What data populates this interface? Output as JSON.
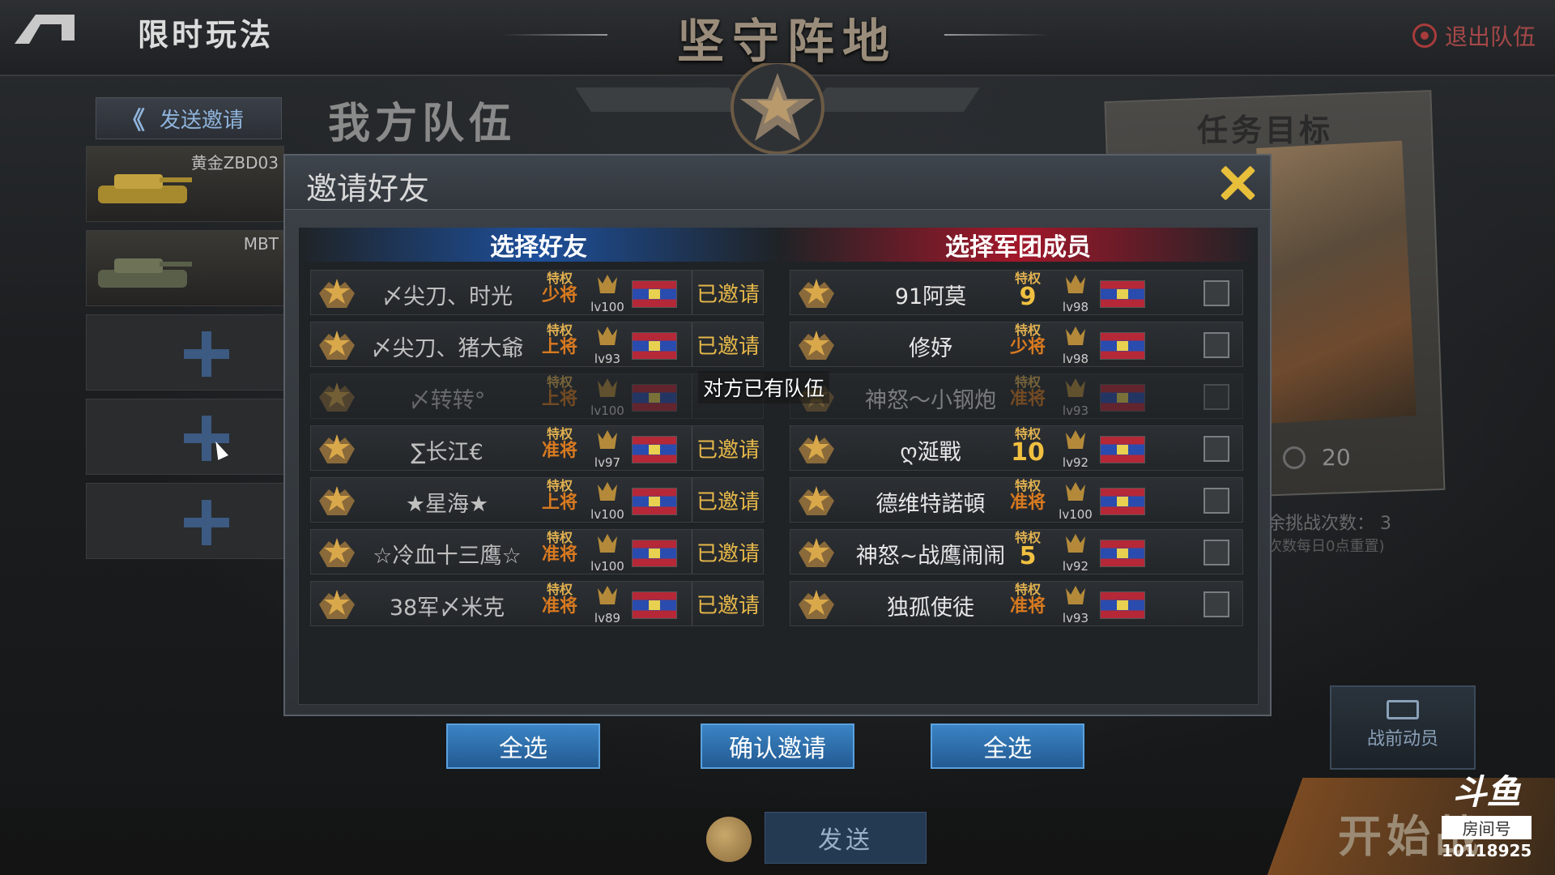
{
  "header": {
    "mode_title": "限时玩法",
    "main_title": "坚守阵地",
    "leave_team_label": "退出队伍"
  },
  "left_panel": {
    "send_invite_label": "发送邀请",
    "our_team_title": "我方队伍",
    "slots": [
      {
        "name": "黄金ZBD03"
      },
      {
        "name": "MBT"
      }
    ]
  },
  "mission": {
    "title": "任务目标",
    "reward_value": "20",
    "remaining_label": "余挑战次数：",
    "remaining_value": "3",
    "reset_note": "次数每日0点重置)"
  },
  "mobilize_label": "战前动员",
  "start_label": "开始战",
  "chat": {
    "send_label": "发送"
  },
  "watermark": {
    "logo": "斗鱼",
    "room_label": "房间号",
    "room_number": "10118925"
  },
  "dialog": {
    "title": "邀请好友",
    "friends_header": "选择好友",
    "legion_header": "选择军团成员",
    "toast": "对方已有队伍",
    "select_all_left": "全选",
    "confirm_invite": "确认邀请",
    "select_all_right": "全选",
    "friends": [
      {
        "name": "〆尖刀、时光",
        "badge_top": "特权",
        "badge_rank": "少将",
        "level": "lv100",
        "status": "已邀请"
      },
      {
        "name": "〆尖刀、猪大爺",
        "badge_top": "特权",
        "badge_rank": "上将",
        "level": "lv93",
        "status": "已邀请"
      },
      {
        "name": "〆转转°",
        "badge_top": "特权",
        "badge_rank": "上将",
        "level": "lv100",
        "status": ""
      },
      {
        "name": "∑长江€",
        "badge_top": "特权",
        "badge_rank": "准将",
        "level": "lv97",
        "status": "已邀请"
      },
      {
        "name": "★星海★",
        "badge_top": "特权",
        "badge_rank": "上将",
        "level": "lv100",
        "status": "已邀请"
      },
      {
        "name": "☆冷血十三鹰☆",
        "badge_top": "特权",
        "badge_rank": "准将",
        "level": "lv100",
        "status": "已邀请"
      },
      {
        "name": "38军〆米克",
        "badge_top": "特权",
        "badge_rank": "准将",
        "level": "lv89",
        "status": "已邀请"
      }
    ],
    "legion": [
      {
        "name": "91阿莫",
        "badge_top": "特权",
        "badge_rank": "9",
        "level": "lv98"
      },
      {
        "name": "修妤",
        "badge_top": "特权",
        "badge_rank": "少将",
        "level": "lv98"
      },
      {
        "name": "神怒～小钢炮",
        "badge_top": "特权",
        "badge_rank": "准将",
        "level": "lv93"
      },
      {
        "name": "ღ涎戰",
        "badge_top": "特权",
        "badge_rank": "10",
        "level": "lv92"
      },
      {
        "name": "德维特諾頓",
        "badge_top": "特权",
        "badge_rank": "准将",
        "level": "lv100"
      },
      {
        "name": "神怒~战鹰闹闹",
        "badge_top": "特权",
        "badge_rank": "5",
        "level": "lv92"
      },
      {
        "name": "独孤使徒",
        "badge_top": "特权",
        "badge_rank": "准将",
        "level": "lv93"
      }
    ]
  },
  "colors": {
    "accent_gold": "#e6b84a",
    "friends_header": "#1e4f9a",
    "legion_header": "#a2172a",
    "button_blue": "#2f74b4"
  }
}
